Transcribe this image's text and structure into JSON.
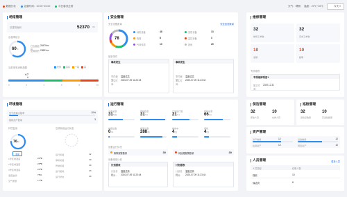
{
  "topbar": {
    "alarm": "数据分析",
    "tab_active": "运营时间：10:00~20:00",
    "tab_state": "今日客流正常",
    "weather": "天气：晴朗",
    "temp": "温度：20℃~26℃",
    "range": "今天"
  },
  "property": {
    "title": "场馆管理",
    "area_label": "总建筑面积",
    "area_value": "52370",
    "area_unit": "m²",
    "rate_title": "出租率统计",
    "rate_pct": "60",
    "rate_unit": "%",
    "rent_label": "已出租面积",
    "rent_value": "28479m²",
    "vacant_label": "空置面积",
    "vacant_value": "23891m²",
    "energy_title": "当前用电消耗指数",
    "legend": [
      "优秀",
      "良好",
      "一般",
      "差"
    ],
    "colors": {
      "excellent": "#2d8cf0",
      "good": "#19be6b",
      "fair": "#ff9900",
      "bad": "#ed4014"
    },
    "marker_value": "4.7",
    "marker_position": 0.47,
    "scale": [
      "0",
      "2",
      "4",
      "6",
      "8",
      "10"
    ]
  },
  "security": {
    "title": "安全管理",
    "device_label": "安全设备数量",
    "link_label": "安全巡查数量",
    "gauge_value": "78",
    "items": [
      {
        "label": "消防设备",
        "value": "48",
        "color": "#2d8cf0"
      },
      {
        "label": "安防设备",
        "value": "13",
        "color": "#19be6b"
      },
      {
        "label": "电梯",
        "value": "8",
        "color": "#ff9900"
      },
      {
        "label": "监控设备",
        "value": "3",
        "color": "#ed4014"
      },
      {
        "label": "气体传感",
        "value": "10",
        "color": "#9254de"
      },
      {
        "label": "其他",
        "value": "20",
        "color": "#bbbbbb"
      }
    ],
    "event_label": "最新事件",
    "events": [
      {
        "name": "事故发生",
        "l1": "事件编号：",
        "v1": "温度过高",
        "l2": "发生时间：",
        "v2": "2020-07-09 11:23:44"
      },
      {
        "name": "事故发生",
        "l1": "事件编号：",
        "v1": "温度过高",
        "l2": "发生时间：",
        "v2": "2020-07-09 11:23:44"
      }
    ]
  },
  "maintenance": {
    "title": "维修管理",
    "stats": [
      {
        "value": "32",
        "label": "维修工单数"
      },
      {
        "value": "32",
        "label": "完成工单数"
      },
      {
        "value": "10",
        "label": "逾期"
      },
      {
        "value": "10",
        "label": "超期"
      }
    ],
    "notice_label": "专项维修",
    "notice_title": "专项维修项目1",
    "notice_l": "施工时间：",
    "notice_v": "2020.12.31"
  },
  "environment": {
    "title": "环境管理",
    "air_label": "空气质量合格率",
    "air_value": "10%",
    "flow_label": "能耗用户数量",
    "flow_value": "3",
    "left_label": "环境监测",
    "right_label": "空调系统运行状态",
    "temp_value": "76",
    "temp_unit": "%",
    "temp_btn": "温度",
    "left_rows": [
      {
        "l": "1号区域温度",
        "v": "20℃"
      },
      {
        "l": "2号区域温度",
        "v": "26℃"
      },
      {
        "l": "3号区域温度",
        "v": "24℃"
      },
      {
        "l": "湿度监测",
        "v": "78%"
      },
      {
        "l": "空气质量",
        "v": "17℃"
      }
    ],
    "right_rows": [
      {
        "l": "运行机组",
        "v": "12"
      },
      {
        "l": "停机机组",
        "v": "19"
      },
      {
        "l": "异常机组",
        "v": "10"
      },
      {
        "l": "运行能耗",
        "v": "23"
      },
      {
        "l": "运行状态",
        "v": "10"
      }
    ]
  },
  "operation": {
    "title": "运行管理",
    "stats": [
      {
        "label": "设备总数",
        "value": "31",
        "unit": "/9台",
        "fill": 0.55,
        "color": "#2d8cf0"
      },
      {
        "label": "能耗数量",
        "value": "31",
        "unit": "/31",
        "fill": 0.95,
        "color": "#2d8cf0"
      },
      {
        "label": "正常运行数",
        "value": "21",
        "unit": "/31",
        "fill": 0.65,
        "color": "#2d8cf0"
      },
      {
        "label": "能耗总量",
        "value": "66",
        "unit": "/kw",
        "fill": 0.72,
        "color": "#2d8cf0"
      },
      {
        "label": "故障设备",
        "value": "0",
        "unit": "/31",
        "fill": 0.04,
        "color": "#2d8cf0"
      },
      {
        "label": "报警设备",
        "value": "288",
        "unit": "/条",
        "fill": 0.85,
        "color": "#2d8cf0"
      },
      {
        "label": "维修中",
        "value": "4",
        "unit": "/台",
        "fill": 0.18,
        "color": "#2d8cf0"
      },
      {
        "label": "停机",
        "value": "4",
        "unit": "/台",
        "fill": 0.18,
        "color": "#2d8cf0"
      }
    ],
    "task_label": "设备运行情况",
    "notice1": "故障报警数量",
    "notice1_val": "30",
    "notice2": "待处理报警数量",
    "notice2_val": "30",
    "plan_label": "设备维保计划",
    "plans": [
      {
        "name": "计划报表",
        "l1": "计划名称：",
        "v1": "温度过高",
        "l2": "时间：",
        "v2": "2020-07-09 11:23:44"
      },
      {
        "name": "计划报表",
        "l1": "计划名称：",
        "v1": "温度过高",
        "l2": "时间：",
        "v2": "2020-07-09 11:23:44"
      }
    ]
  },
  "cleaning": {
    "title": "保洁管理",
    "stats": [
      {
        "value": "32",
        "label": "保洁人员"
      },
      {
        "value": "10",
        "label": "在岗人员"
      }
    ]
  },
  "patrol": {
    "title": "巡检管理",
    "stats": [
      {
        "value": "32",
        "label": "巡检点数量"
      },
      {
        "value": "10",
        "label": "已巡检数量"
      }
    ]
  },
  "assets": {
    "title": "资产管理",
    "rows": [
      {
        "l": "资产数量",
        "v": "12",
        "l2": "设备数量",
        "v2": "12"
      },
      {
        "l": "固定资产",
        "v": "13",
        "l2": "在用数量",
        "v2": "10"
      }
    ],
    "bar_labels": [
      {
        "l": "在用资产",
        "v": "12"
      },
      {
        "l": "闲置资产",
        "v": "10"
      }
    ]
  },
  "staff": {
    "title": "人员管理",
    "link": "更多人员",
    "header": [
      "人员类型",
      "在职人数"
    ],
    "rows": [
      {
        "l": "保安",
        "v": "10"
      },
      {
        "l": "保洁员",
        "v": "8"
      }
    ]
  }
}
